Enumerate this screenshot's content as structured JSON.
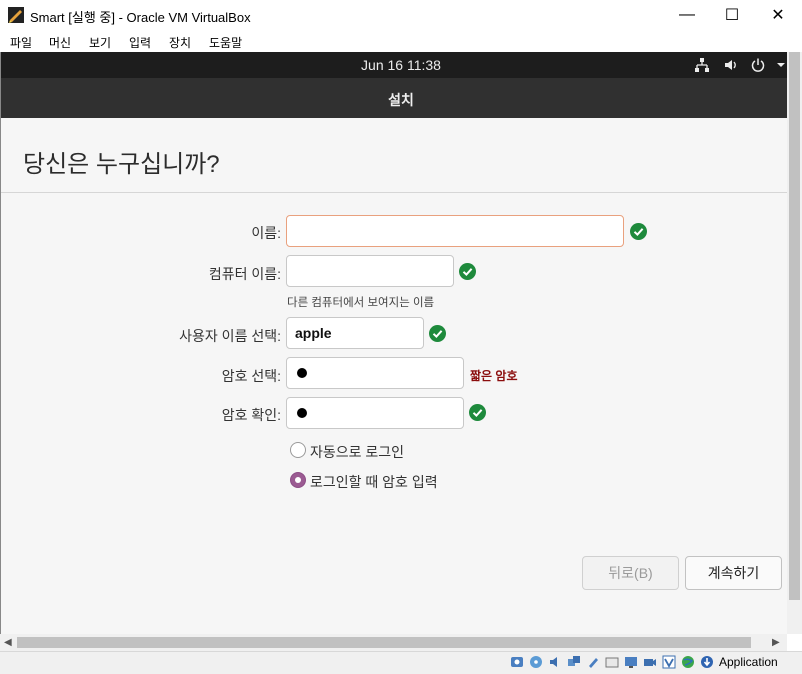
{
  "window": {
    "title": "Smart [실행 중] - Oracle VM VirtualBox",
    "minimize": "—",
    "maximize": "☐",
    "close": "✕"
  },
  "menu": [
    "파일",
    "머신",
    "보기",
    "입력",
    "장치",
    "도움말"
  ],
  "vm_topbar": {
    "clock": "Jun 16  11:38"
  },
  "header": {
    "title": "설치"
  },
  "page": {
    "title": "당신은 누구십니까?"
  },
  "form": {
    "name_label": "이름:",
    "name_value": "",
    "computer_label": "컴퓨터 이름:",
    "computer_value": "",
    "computer_hint": "다른 컴퓨터에서 보여지는 이름",
    "username_label": "사용자 이름 선택:",
    "username_value": "apple",
    "password_label": "암호 선택:",
    "password_warning": "짧은 암호",
    "confirm_label": "암호 확인:",
    "auto_login_label": "자동으로 로그인",
    "require_password_label": "로그인할 때 암호 입력",
    "selected_option": "require_password"
  },
  "buttons": {
    "back": "뒤로(B)",
    "continue": "계속하기"
  },
  "status": {
    "text": "Application"
  },
  "colors": {
    "check": "#1e8a3c",
    "radio": "#9b5b92",
    "warning": "#8b0d0d",
    "focus": "#e9a17e"
  }
}
